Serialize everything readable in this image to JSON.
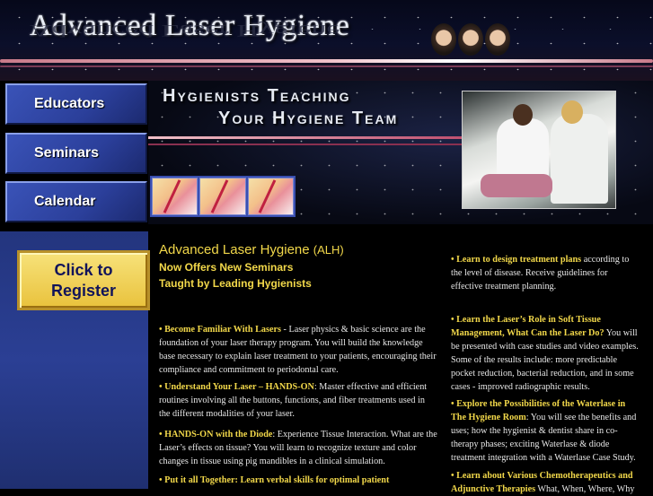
{
  "header": {
    "site_title": "Advanced Laser Hygiene",
    "tagline_line1": "Hygienists Teaching",
    "tagline_line2": "Your Hygiene Team"
  },
  "nav": {
    "items": [
      {
        "label": "Educators"
      },
      {
        "label": "Seminars"
      },
      {
        "label": "Calendar"
      }
    ],
    "register_line1": "Click to",
    "register_line2": "Register"
  },
  "main": {
    "title": "Advanced Laser Hygiene",
    "title_abbr": "(ALH)",
    "subtitle1": "Now Offers New Seminars",
    "subtitle2": "Taught by Leading Hygienists",
    "left_items": [
      {
        "lead": "• Become Familiar With Lasers",
        "text": " - Laser physics & basic science are the foundation of your laser therapy program. You will build the knowledge base necessary to explain laser treatment to your patients, encouraging their compliance and commitment to periodontal care."
      },
      {
        "lead": "• Understand Your Laser – HANDS-ON",
        "text": ": Master effective and efficient routines involving all the buttons, functions, and fiber treatments used in the different modalities of your laser."
      },
      {
        "lead": "• HANDS-ON with the Diode",
        "text": ": Experience Tissue Interaction. What are the Laser’s effects on tissue? You will learn to recognize texture and color changes in tissue using pig mandibles in a clinical simulation."
      },
      {
        "lead": "• Put it all Together: Learn verbal skills for optimal patient",
        "text": ""
      }
    ],
    "right_items": [
      {
        "lead": "• Learn to design treatment plans",
        "text": " according to the level of disease. Receive guidelines for effective treatment planning."
      },
      {
        "lead": "• Learn the Laser’s Role in Soft Tissue Management, What Can the Laser Do?",
        "text": " You will be presented with case studies and video examples. Some of the results include: more predictable pocket reduction, bacterial reduction, and in some cases - improved radiographic results."
      },
      {
        "lead": "• Explore the Possibilities of the Waterlase in The Hygiene Room",
        "text": ": You will see the benefits and uses; how the hygienist & dentist share in co-therapy phases; exciting Waterlase & diode treatment integration with a Waterlase Case Study."
      },
      {
        "lead": "• Learn about Various Chemotherapeutics and Adjunctive Therapies",
        "text": " What, When, Where, Why"
      }
    ]
  },
  "colors": {
    "accent_gold": "#f2d84a",
    "nav_blue": "#2b3f9a",
    "background": "#000000"
  }
}
